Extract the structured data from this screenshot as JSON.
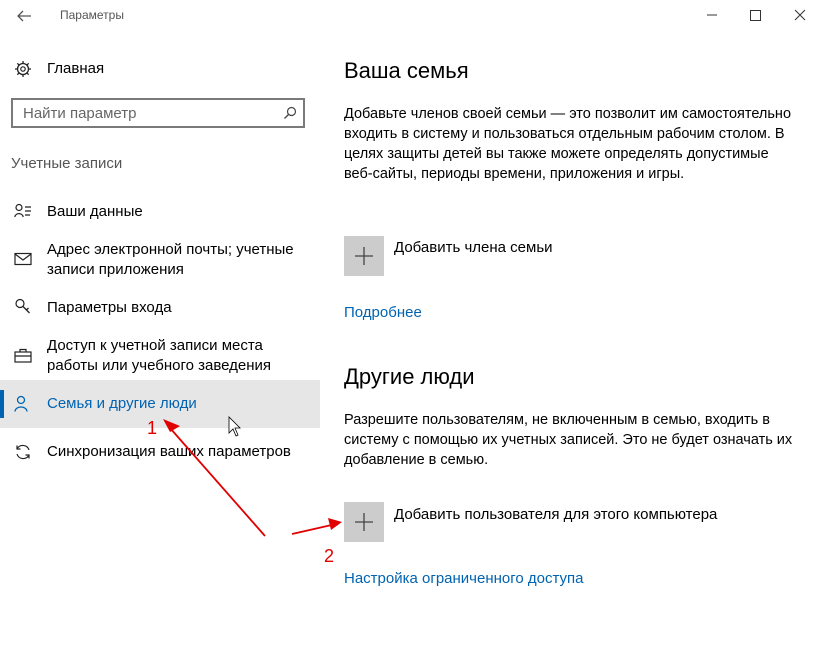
{
  "window": {
    "title": "Параметры",
    "back_icon": "arrow-left-icon",
    "controls": [
      "minimize-icon",
      "maximize-icon",
      "close-icon"
    ]
  },
  "sidebar": {
    "home_label": "Главная",
    "search": {
      "placeholder": "Найти параметр"
    },
    "section_title": "Учетные записи",
    "items": [
      {
        "label": "Ваши данные",
        "icon": "person-card-icon",
        "active": false
      },
      {
        "label": "Адрес электронной почты; учетные записи приложения",
        "icon": "mail-icon",
        "active": false
      },
      {
        "label": "Параметры входа",
        "icon": "key-icon",
        "active": false
      },
      {
        "label": "Доступ к учетной записи места работы или учебного заведения",
        "icon": "briefcase-icon",
        "active": false
      },
      {
        "label": "Семья и другие люди",
        "icon": "person-add-icon",
        "active": true
      },
      {
        "label": "Синхронизация ваших параметров",
        "icon": "sync-icon",
        "active": false
      }
    ]
  },
  "main": {
    "family": {
      "title": "Ваша семья",
      "description": "Добавьте членов своей семьи — это позволит им самостоятельно входить в систему и пользоваться отдельным рабочим столом. В целях защиты детей вы также можете определять допустимые веб-сайты, периоды времени, приложения и игры.",
      "add_label": "Добавить члена семьи",
      "link": "Подробнее"
    },
    "others": {
      "title": "Другие люди",
      "description": "Разрешите пользователям, не включенным в семью, входить в систему с помощью их учетных записей. Это не будет означать их добавление в семью.",
      "add_label": "Добавить пользователя для этого компьютера",
      "link": "Настройка ограниченного доступа"
    }
  },
  "annotations": {
    "marks": [
      "1",
      "2"
    ],
    "color": "#e00000"
  },
  "colors": {
    "accent": "#0063b1",
    "tile": "#cccccc",
    "active_bg": "#e6e6e6"
  }
}
